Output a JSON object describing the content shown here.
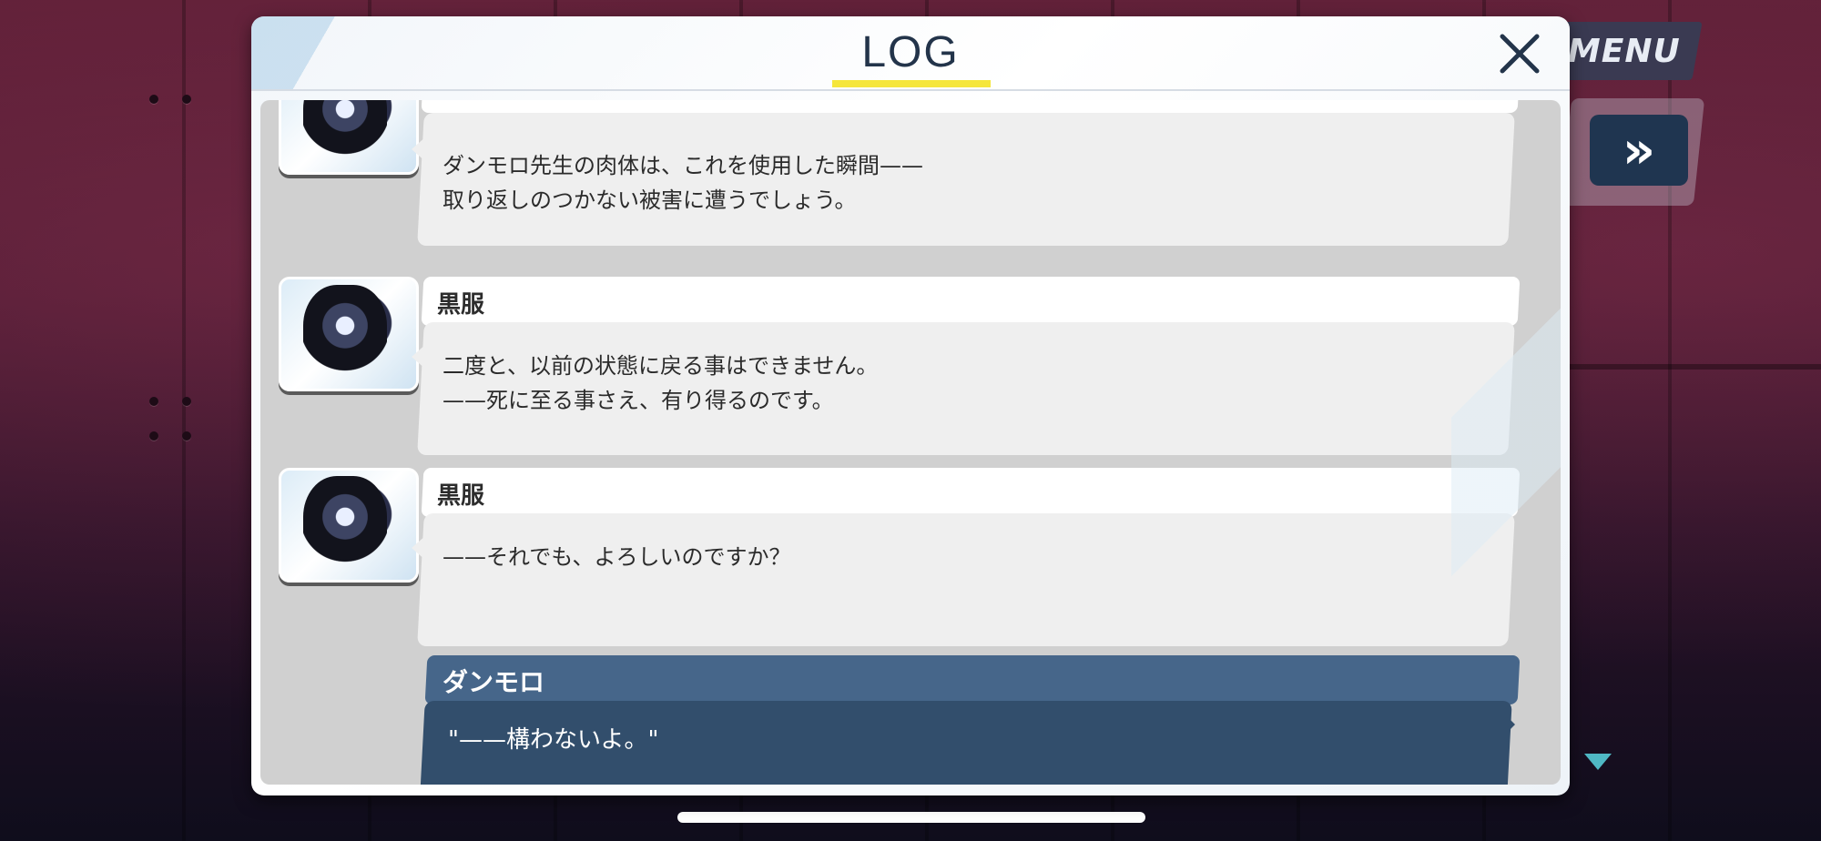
{
  "hud": {
    "menu_label": "MENU",
    "skip_label": "»"
  },
  "log": {
    "title": "LOG",
    "close_label": "✕",
    "entries": [
      {
        "speaker": "",
        "lines": [
          "ダンモロ先生の肉体は、これを使用した瞬間——",
          "取り返しのつかない被害に遭うでしょう。"
        ]
      },
      {
        "speaker": "黒服",
        "lines": [
          "二度と、以前の状態に戻る事はできません。",
          "——死に至る事さえ、有り得るのです。"
        ]
      },
      {
        "speaker": "黒服",
        "lines": [
          "——それでも、よろしいのですか？"
        ]
      }
    ],
    "player_entry": {
      "speaker": "ダンモロ",
      "line": "\"——構わないよ。\""
    }
  },
  "colors": {
    "accent_yellow": "#f5e63b",
    "player_plate": "#46668a",
    "player_bubble": "#324e6c",
    "title_navy": "#23344a"
  }
}
